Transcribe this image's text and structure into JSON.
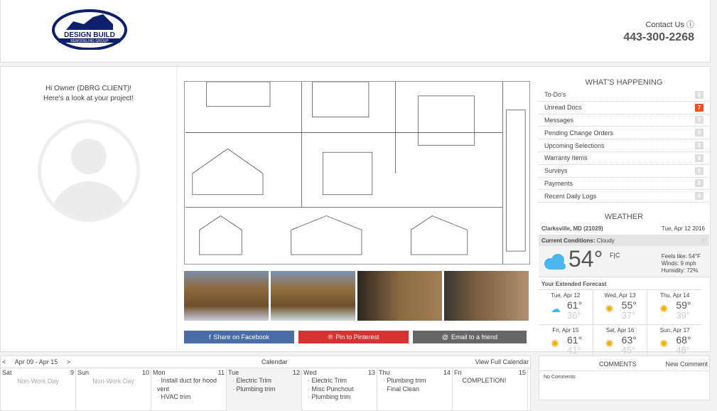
{
  "header": {
    "logo_text": "DESIGN BUILD REMODELING GROUP MARYLAND",
    "contact_label": "Contact Us",
    "phone": "443-300-2268"
  },
  "profile": {
    "greeting": "Hi Owner (DBRG CLIENT)!",
    "subtitle": "Here's a look at your project!"
  },
  "share": {
    "facebook": "Share on Facebook",
    "pinterest": "Pin to Pinterest",
    "email": "Email to a friend",
    "colors": {
      "facebook": "#4a6da7",
      "pinterest": "#d93232",
      "email": "#666666"
    }
  },
  "whats_happening": {
    "title": "WHAT'S HAPPENING",
    "items": [
      {
        "label": "To-Do's",
        "count": "0"
      },
      {
        "label": "Unread Docs",
        "count": "7"
      },
      {
        "label": "Messages",
        "count": "0"
      },
      {
        "label": "Pending Change Orders",
        "count": "0"
      },
      {
        "label": "Upcoming Selections",
        "count": "0"
      },
      {
        "label": "Warranty Items",
        "count": "0"
      },
      {
        "label": "Surveys",
        "count": "0"
      },
      {
        "label": "Payments",
        "count": "0"
      },
      {
        "label": "Recent Daily Logs",
        "count": "0"
      }
    ]
  },
  "weather": {
    "title": "WEATHER",
    "location": "Clarksville, MD (21029)",
    "date": "Tue, Apr 12 2016",
    "conditions_label": "Current Conditions:",
    "conditions": "Cloudy",
    "temp": "54°",
    "units": "F|C",
    "feels": "Feels like: 54°F",
    "winds": "Winds: 9 mph",
    "humidity": "Humidity: 72%",
    "extended_label": "Your Extended Forecast",
    "forecast": [
      {
        "day": "Tue, Apr 12",
        "hi": "61°",
        "lo": "36°",
        "icon": "rain-cloud-icon"
      },
      {
        "day": "Wed, Apr 13",
        "hi": "55°",
        "lo": "37°",
        "icon": "sun-icon"
      },
      {
        "day": "Thu, Apr 14",
        "hi": "59°",
        "lo": "39°",
        "icon": "sun-icon"
      },
      {
        "day": "Fri, Apr 15",
        "hi": "61°",
        "lo": "41°",
        "icon": "sun-icon"
      },
      {
        "day": "Sat, Apr 16",
        "hi": "63°",
        "lo": "45°",
        "icon": "sun-icon"
      },
      {
        "day": "Sun, Apr 17",
        "hi": "68°",
        "lo": "48°",
        "icon": "sun-icon"
      }
    ]
  },
  "calendar": {
    "prev": "<",
    "range": "Apr 09 - Apr 15",
    "next": ">",
    "title": "Calendar",
    "view_full": "View Full Calendar",
    "days": [
      {
        "name": "Sat",
        "num": "9",
        "nonwork": "Non-Work Day",
        "items": []
      },
      {
        "name": "Sun",
        "num": "10",
        "nonwork": "Non-Work Day",
        "items": []
      },
      {
        "name": "Mon",
        "num": "11",
        "items": [
          "Install duct for hood vent",
          "HVAC trim"
        ]
      },
      {
        "name": "Tue",
        "num": "12",
        "items": [
          "Electric Trim",
          "Plumbing trim"
        ]
      },
      {
        "name": "Wed",
        "num": "13",
        "items": [
          "Electric Trim",
          "Misc Punchout",
          "Plumbing trim"
        ]
      },
      {
        "name": "Thu",
        "num": "14",
        "items": [
          "Plumbing trim",
          "Final Clean"
        ]
      },
      {
        "name": "Fri",
        "num": "15",
        "items": [
          "COMPLETION!"
        ]
      }
    ]
  },
  "comments": {
    "title": "COMMENTS",
    "new": "New Comment",
    "empty": "No Comments"
  }
}
